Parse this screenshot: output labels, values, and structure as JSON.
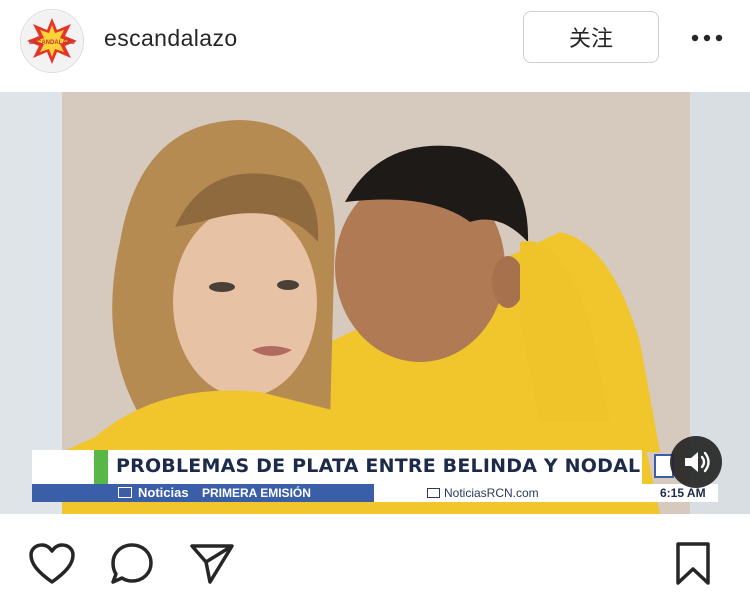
{
  "header": {
    "username": "escandalazo",
    "follow_label": "关注",
    "avatar_text": "ESCANDALAZO"
  },
  "media": {
    "headline": "PROBLEMAS DE PLATA ENTRE BELINDA Y NODAL",
    "program_name": "Noticias",
    "edition": "PRIMERA EMISIÓN",
    "handle": "NoticiasRCN.com",
    "time": "6:15 AM"
  },
  "actions": {
    "like": "heart-icon",
    "comment": "comment-icon",
    "share": "send-icon",
    "save": "bookmark-icon"
  },
  "colors": {
    "accent_green": "#57b847",
    "ticker_blue": "#3a5ea8",
    "sweater_yellow": "#f0c62c"
  }
}
